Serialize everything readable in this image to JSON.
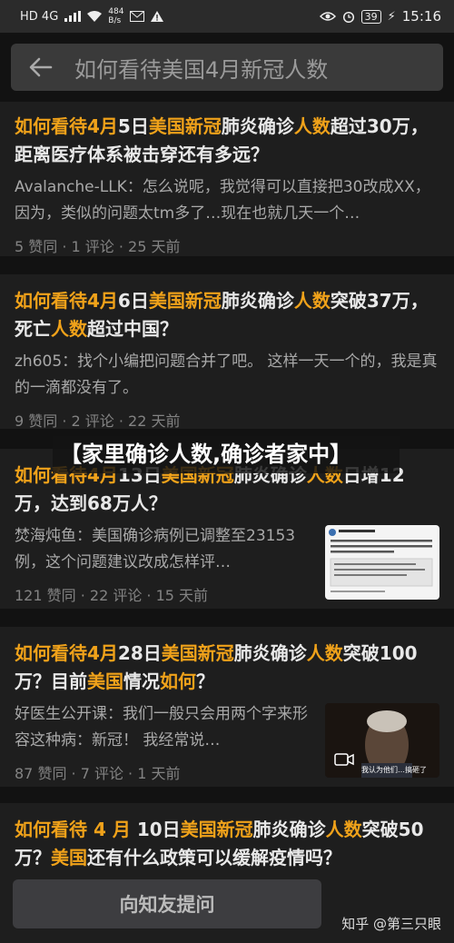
{
  "statusbar": {
    "network": "HD 4G",
    "speed_value": "484",
    "speed_unit": "B/s",
    "battery": "39",
    "time": "15:16"
  },
  "search": {
    "query": "如何看待美国4月新冠人数"
  },
  "results": [
    {
      "title": "如何看待4月5日美国新冠肺炎确诊人数超过30万，距离医疗体系被击穿还有多远？",
      "excerpt": "Avalanche-LLK：怎么说呢，我觉得可以直接把30改成XX，因为，类似的问题太tm多了…现在也就几天一个…",
      "meta": "5 赞同 · 1 评论 · 25 天前"
    },
    {
      "title": "如何看待4月6日美国新冠肺炎确诊人数突破37万，死亡人数超过中国？",
      "excerpt": "zh605：找个小编把问题合并了吧。 这样一天一个的，我是真的一滴都没有了。",
      "meta": "9 赞同 · 2 评论 · 22 天前"
    },
    {
      "title": "如何看待4月13日美国新冠肺炎确诊人数日增12万，达到68万人？",
      "excerpt": "焚海炖鱼：美国确诊病例已调整至23153例，这个问题建议改成怎样评…",
      "meta": "121 赞同 · 22 评论 · 15 天前",
      "thumb": "tweet-screenshot"
    },
    {
      "title": "如何看待4月28日美国新冠肺炎确诊人数突破100万？目前美国情况如何？",
      "excerpt": "好医生公开课：我们一般只会用两个字来形容这种病：新冠！ 我经常说…",
      "meta": "87 赞同 · 7 评论 · 1 天前",
      "thumb": "video",
      "thumb_caption": "我认为他们…搞砸了"
    },
    {
      "title": "如何看待 4 月 10日美国新冠肺炎确诊人数突破50万？美国还有什么政策可以缓解疫情吗？"
    }
  ],
  "overlay_headline": "【家里确诊人数,确诊者家中】",
  "ask_button": "向知友提问",
  "watermark": "知乎 @第三只眼",
  "colors": {
    "highlight": "#f0a21a",
    "background": "#121212",
    "card": "#1e1e1e"
  }
}
